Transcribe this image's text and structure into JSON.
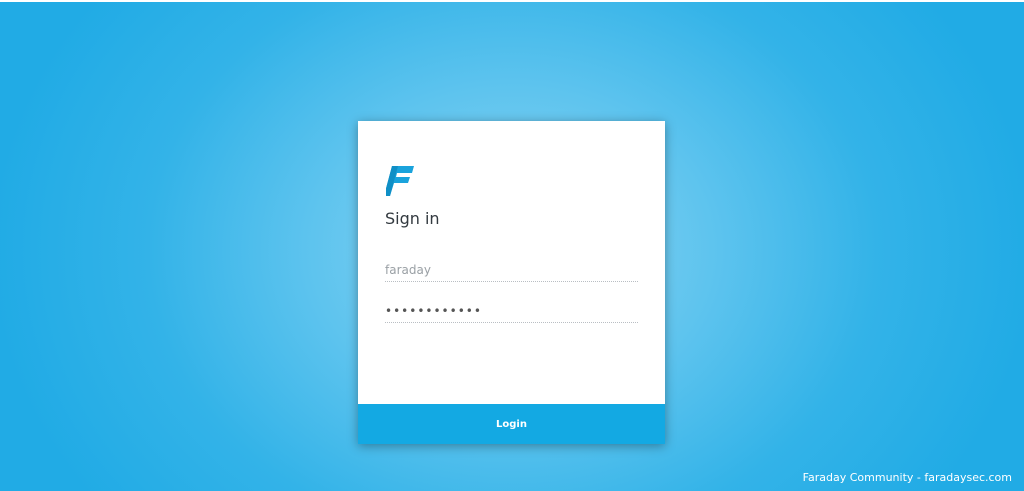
{
  "login_card": {
    "title": "Sign in",
    "username": {
      "value": "",
      "placeholder": "faraday"
    },
    "password": {
      "value": "••••••••••••",
      "placeholder": ""
    },
    "login_label": "Login"
  },
  "footer": {
    "text": "Faraday Community - faradaysec.com"
  },
  "icons": {
    "logo": "faraday-logo-icon"
  },
  "colors": {
    "background": "#21abe5",
    "brand": "#13a9e3",
    "card": "#ffffff"
  }
}
